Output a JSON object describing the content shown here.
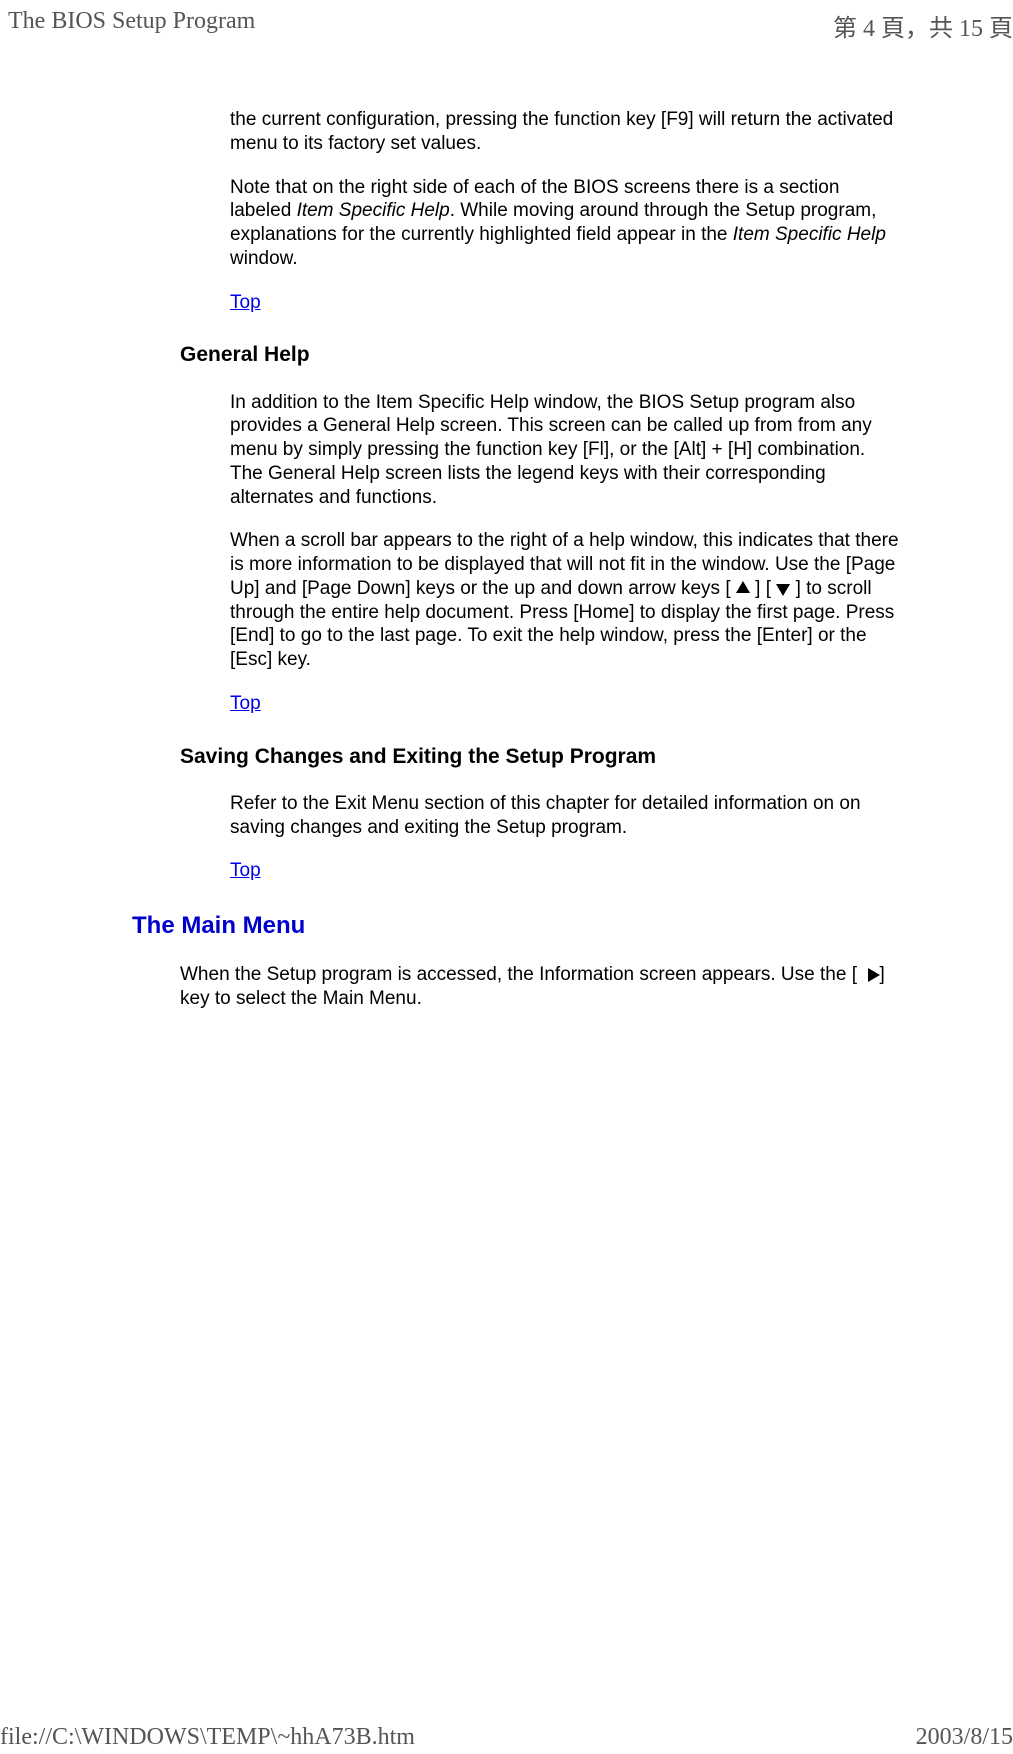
{
  "header": {
    "title": "The BIOS Setup Program",
    "page_info": "第 4 頁，共 15 頁"
  },
  "sections": {
    "para_config": "the current configuration, pressing the function key [F9] will return the activated menu to its factory set values.",
    "para_note_pre": "Note that on the right side of each of the BIOS screens there is a section labeled ",
    "para_note_italic1": "Item Specific Help",
    "para_note_mid": ". While moving around through the Setup program, explanations for the currently highlighted field appear in the ",
    "para_note_italic2": "Item Specific Help",
    "para_note_post": " window.",
    "top_link": "Top",
    "general_help_heading": "General Help",
    "gh_para1": "In addition to the Item Specific Help window, the BIOS Setup program also provides a General Help screen. This screen can be called up from from any menu by simply pressing the function key [Fl], or the [Alt] + [H] combination. The General Help screen lists the legend keys with their corresponding alternates and functions.",
    "gh_para2_pre": "When a scroll bar appears to the right of a help window, this indicates that there is more information to be displayed that will not fit in the window. Use the [Page Up] and [Page Down] keys or the up and down arrow keys [ ",
    "gh_para2_mid": " ] [ ",
    "gh_para2_post": " ] to scroll through the entire help document. Press [Home] to display the first page. Press [End] to go to the last page. To exit the help window, press the [Enter] or the [Esc] key.",
    "saving_heading": "Saving Changes and Exiting the Setup Program",
    "saving_para": "Refer to the Exit Menu section of this chapter for detailed information on on saving changes and exiting the Setup program.",
    "main_menu_heading": "The Main Menu",
    "main_menu_para_pre": "When the Setup program is accessed, the Information screen appears. Use the [ ",
    "main_menu_para_post": "] key to select the Main Menu."
  },
  "footer": {
    "path": "file://C:\\WINDOWS\\TEMP\\~hhA73B.htm",
    "date": "2003/8/15"
  }
}
